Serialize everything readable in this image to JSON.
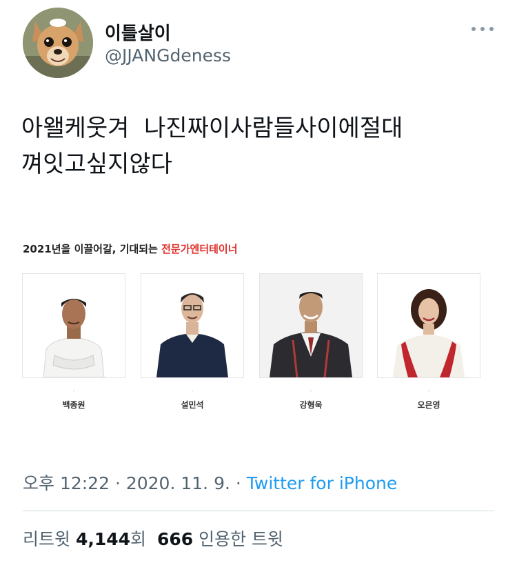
{
  "user": {
    "display_name": "이틀살이",
    "handle": "@JJANGdeness"
  },
  "tweet": {
    "line1": "아왤케웃겨  나진짜이사람들사이에절대",
    "line2": "껴잇고싶지않다"
  },
  "card": {
    "title_prefix": "2021년을 이끌어갈, 기대되는 ",
    "title_highlight": "전문가엔터테이너",
    "people": [
      {
        "name": "백종원"
      },
      {
        "name": "설민석"
      },
      {
        "name": "강형욱"
      },
      {
        "name": "오은영"
      }
    ],
    "separator": "-"
  },
  "meta": {
    "time": "오후 12:22",
    "sep1": " · ",
    "date": "2020. 11. 9.",
    "sep2": " · ",
    "source": "Twitter for iPhone"
  },
  "stats": {
    "retweet_label": "리트윗 ",
    "retweet_count": "4,144",
    "retweet_suffix": "회",
    "quote_count": "666",
    "quote_label": " 인용한 트윗"
  },
  "colors": {
    "accent": "#1d9bf0",
    "highlight": "#e0302c"
  },
  "icons": [
    "more-options-icon"
  ]
}
